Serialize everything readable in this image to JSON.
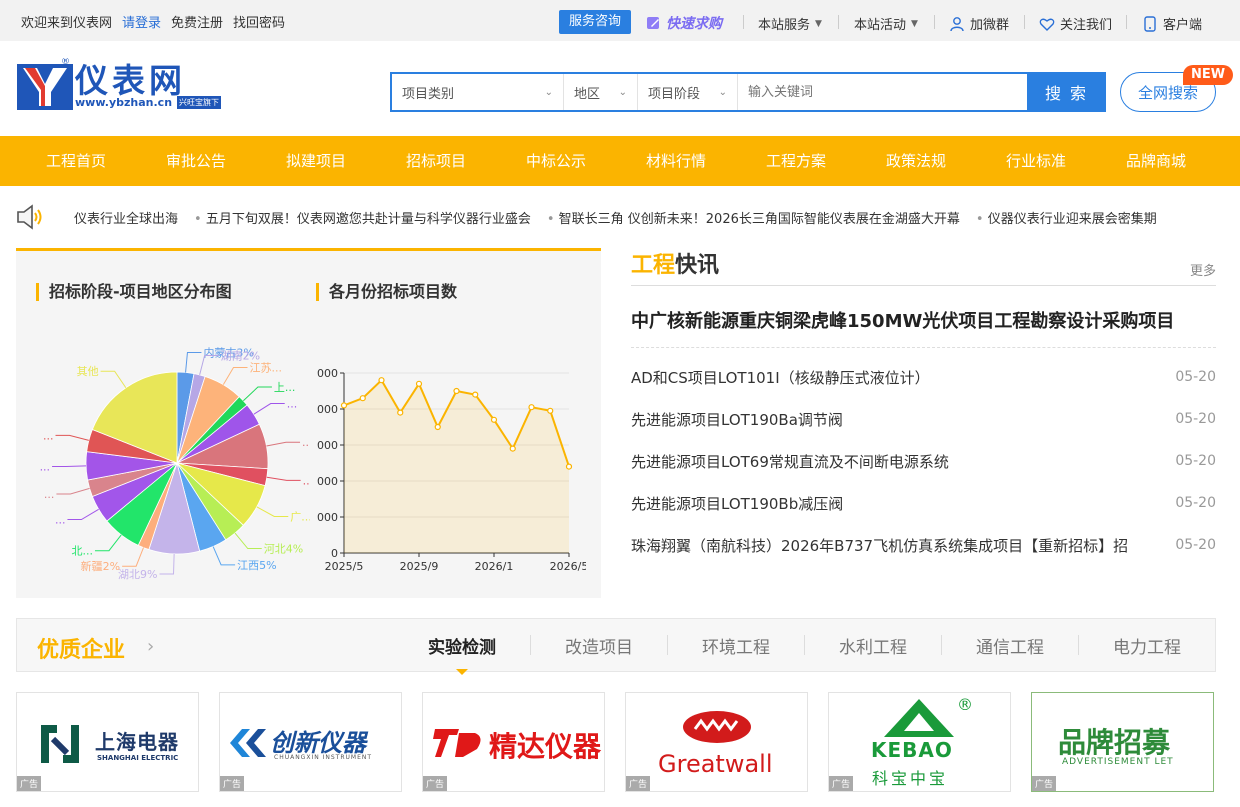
{
  "topbar": {
    "welcome": "欢迎来到仪表网",
    "login": "请登录",
    "register": "免费注册",
    "recover": "找回密码",
    "service": "服务咨询",
    "quick_buy": "快速求购",
    "site_services": "本站服务",
    "site_events": "本站活动",
    "wechat_group": "加微群",
    "follow_us": "关注我们",
    "client": "客户端"
  },
  "header": {
    "logo_cn": "仪表网",
    "logo_url": "www.ybzhan.cn",
    "logo_tag": "兴旺宝旗下",
    "search": {
      "category": "项目类别",
      "region": "地区",
      "stage": "项目阶段",
      "placeholder": "输入关键词",
      "button": "搜 索",
      "all": "全网搜索",
      "new_badge": "NEW"
    }
  },
  "nav": [
    "工程首页",
    "审批公告",
    "拟建项目",
    "招标项目",
    "中标公示",
    "材料行情",
    "工程方案",
    "政策法规",
    "行业标准",
    "品牌商城"
  ],
  "ticker": [
    "仪表行业全球出海",
    "五月下旬双展！仪表网邀您共赴计量与科学仪器行业盛会",
    "智联长三角 仪创新未来！2026长三角国际智能仪表展在金湖盛大开幕",
    "仪器仪表行业迎来展会密集期"
  ],
  "charts": {
    "pie_title": "招标阶段-项目地区分布图",
    "line_title": "各月份招标项目数"
  },
  "chart_data": [
    {
      "type": "pie",
      "title": "招标阶段-项目地区分布图",
      "slices": [
        {
          "label": "内蒙古3%",
          "value": 3,
          "color": "#5b9ae8"
        },
        {
          "label": "湖南2%",
          "value": 2,
          "color": "#b6a7e6"
        },
        {
          "label": "江苏...",
          "value": 7,
          "color": "#fdb37a"
        },
        {
          "label": "上...",
          "value": 2,
          "color": "#22d85a"
        },
        {
          "label": "...",
          "value": 4,
          "color": "#9f55ea"
        },
        {
          "label": "...",
          "value": 8,
          "color": "#d9757c"
        },
        {
          "label": "...",
          "value": 3,
          "color": "#e05060"
        },
        {
          "label": "广...",
          "value": 8,
          "color": "#e6e84a"
        },
        {
          "label": "河北4%",
          "value": 4,
          "color": "#b7ee55"
        },
        {
          "label": "江西5%",
          "value": 5,
          "color": "#5aa6f0"
        },
        {
          "label": "湖北9%",
          "value": 9,
          "color": "#c4b4ea"
        },
        {
          "label": "新疆2%",
          "value": 2,
          "color": "#fdae7d"
        },
        {
          "label": "北...",
          "value": 7,
          "color": "#22e56a"
        },
        {
          "label": "...",
          "value": 5,
          "color": "#a256ea"
        },
        {
          "label": "...",
          "value": 3,
          "color": "#d9848c"
        },
        {
          "label": "...",
          "value": 5,
          "color": "#a355e8"
        },
        {
          "label": "...",
          "value": 4,
          "color": "#e05555"
        },
        {
          "label": "其他",
          "value": 19,
          "color": "#e8e658"
        }
      ]
    },
    {
      "type": "line",
      "title": "各月份招标项目数",
      "x": [
        "2025/5",
        "2025/6",
        "2025/7",
        "2025/8",
        "2025/9",
        "2025/10",
        "2025/11",
        "2025/12",
        "2026/1",
        "2026/2",
        "2026/3",
        "2026/4",
        "2026/5"
      ],
      "xticks": [
        "2025/5",
        "2025/9",
        "2026/1",
        "2026/5"
      ],
      "yticks": [
        "0",
        "000",
        "000",
        "000",
        "000",
        "000"
      ],
      "values": [
        4.1,
        4.3,
        4.8,
        3.9,
        4.7,
        3.5,
        4.5,
        4.4,
        3.7,
        2.9,
        4.05,
        3.95,
        2.4
      ],
      "ylim": [
        0,
        5
      ],
      "color": "#fbb400",
      "grid": true
    }
  ],
  "news": {
    "title_a": "工程",
    "title_b": "快讯",
    "more": "更多",
    "headline": "中广核新能源重庆铜梁虎峰150MW光伏项目工程勘察设计采购项目",
    "items": [
      {
        "text": "AD和CS项目LOT101I（核级静压式液位计）",
        "date": "05-20"
      },
      {
        "text": "先进能源项目LOT190Ba调节阀",
        "date": "05-20"
      },
      {
        "text": "先进能源项目LOT69常规直流及不间断电源系统",
        "date": "05-20"
      },
      {
        "text": "先进能源项目LOT190Bb减压阀",
        "date": "05-20"
      },
      {
        "text": "珠海翔翼（南航科技）2026年B737飞机仿真系统集成项目【重新招标】招",
        "date": "05-20"
      }
    ]
  },
  "enterprises": {
    "title": "优质企业",
    "tabs": [
      "实验检测",
      "改造项目",
      "环境工程",
      "水利工程",
      "通信工程",
      "电力工程"
    ],
    "ad_tag": "广告",
    "logos": [
      {
        "name": "上海电器",
        "sub": "SHANGHAI ELECTRIC"
      },
      {
        "name": "创新仪器",
        "sub": "CHUANGXIN INSTRUMENT"
      },
      {
        "name": "精达仪器",
        "sub": ""
      },
      {
        "name": "Greatwall",
        "sub": ""
      },
      {
        "name": "KEBAO",
        "sub": "科宝中宝"
      },
      {
        "name": "品牌招募",
        "sub": "ADVERTISEMENT LET"
      }
    ]
  }
}
